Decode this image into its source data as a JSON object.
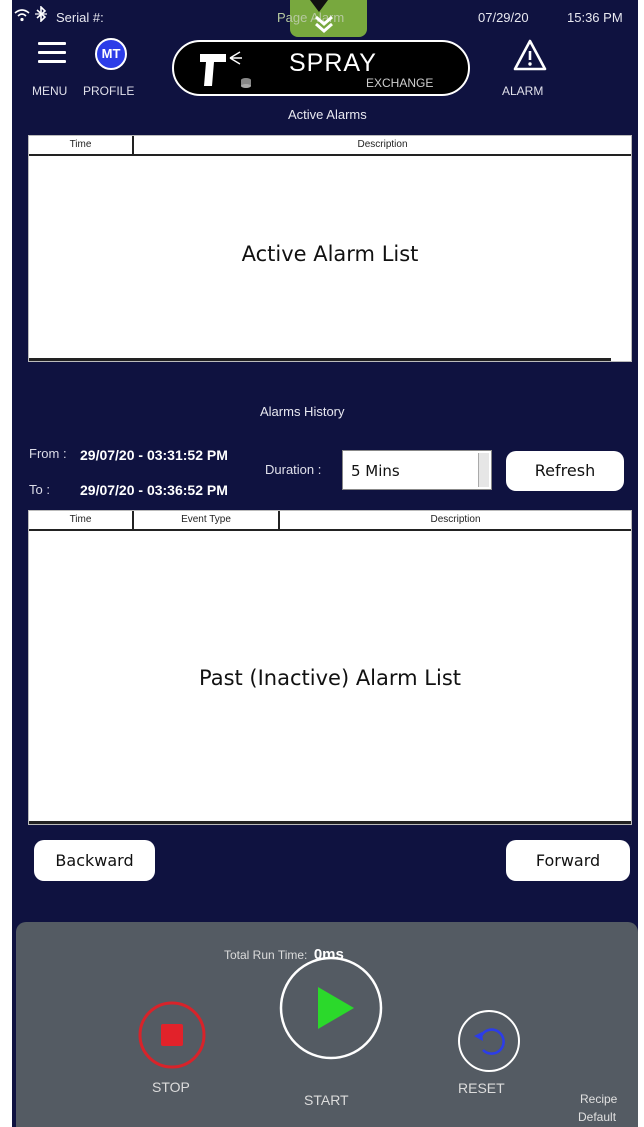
{
  "status_bar": {
    "serial_label": "Serial #:",
    "page_label": "Page Alarm",
    "date": "07/29/20",
    "time": "15:36 PM"
  },
  "header": {
    "menu_label": "MENU",
    "profile_initials": "MT",
    "profile_label": "PROFILE",
    "app_title": "SPRAY",
    "app_subtitle": "EXCHANGE",
    "alarm_label": "ALARM"
  },
  "active_alarms": {
    "title": "Active Alarms",
    "columns": [
      "Time",
      "Description"
    ],
    "placeholder": "Active Alarm List"
  },
  "alarms_history": {
    "title": "Alarms History",
    "from_label": "From :",
    "from_value": "29/07/20 - 03:31:52 PM",
    "to_label": "To :",
    "to_value": "29/07/20 - 03:36:52 PM",
    "duration_label": "Duration :",
    "duration_value": "5 Mins",
    "refresh_label": "Refresh",
    "columns": [
      "Time",
      "Event Type",
      "Description"
    ],
    "placeholder": "Past (Inactive) Alarm List",
    "backward_label": "Backward",
    "forward_label": "Forward"
  },
  "controls": {
    "run_time_label": "Total Run Time:",
    "run_time_value": "0ms",
    "stop_label": "STOP",
    "start_label": "START",
    "reset_label": "RESET",
    "recipe_label": "Recipe",
    "recipe_value": "Default"
  },
  "colors": {
    "background": "#0f1240",
    "page_tab": "#78a83e",
    "stop": "#d8232a",
    "start": "#2bd92b",
    "reset": "#2c3de8",
    "panel": "#545b63"
  }
}
